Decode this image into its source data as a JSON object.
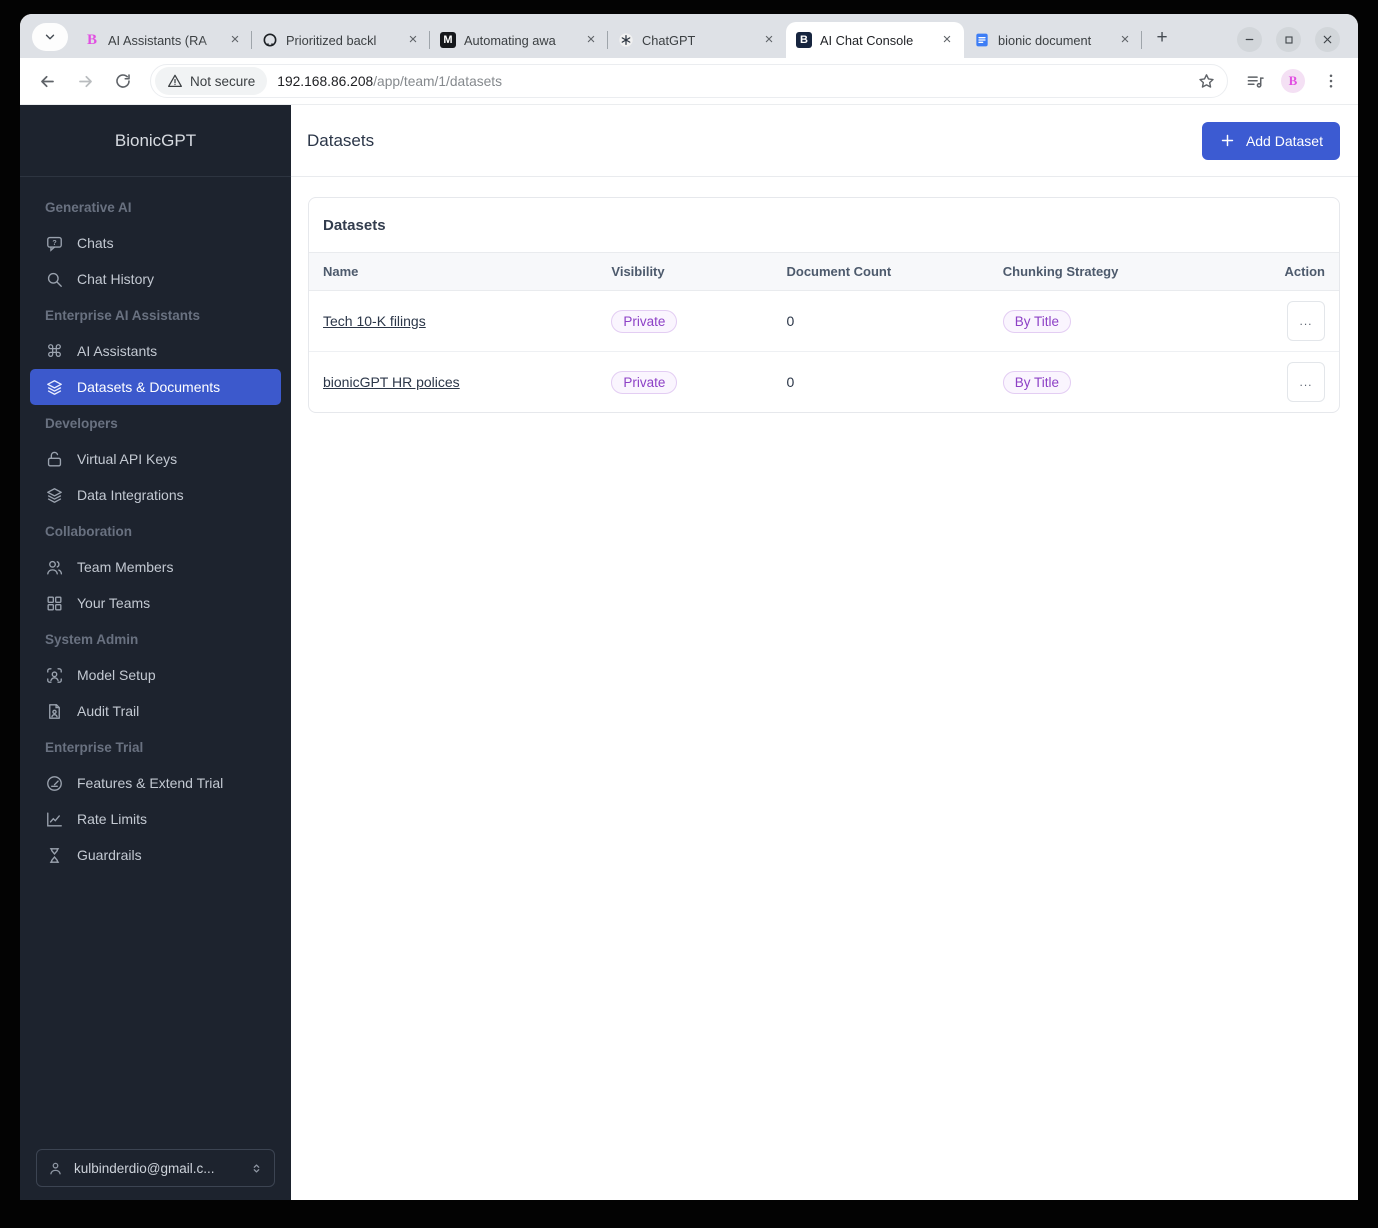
{
  "browser": {
    "tabs": [
      {
        "title": "AI Assistants (RA",
        "favicon": "bionic-pink",
        "active": false
      },
      {
        "title": "Prioritized backl",
        "favicon": "github",
        "active": false
      },
      {
        "title": "Automating awa",
        "favicon": "medium",
        "active": false
      },
      {
        "title": "ChatGPT",
        "favicon": "chatgpt",
        "active": false
      },
      {
        "title": "AI Chat Console",
        "favicon": "bionic-navy",
        "active": true
      },
      {
        "title": "bionic document",
        "favicon": "docs",
        "active": false
      }
    ],
    "security_label": "Not secure",
    "url_host": "192.168.86.208",
    "url_path": "/app/team/1/datasets"
  },
  "sidebar": {
    "brand": "BionicGPT",
    "sections": [
      {
        "label": "Generative AI",
        "items": [
          {
            "label": "Chats",
            "icon": "chat"
          },
          {
            "label": "Chat History",
            "icon": "search"
          }
        ]
      },
      {
        "label": "Enterprise AI Assistants",
        "items": [
          {
            "label": "AI Assistants",
            "icon": "command"
          },
          {
            "label": "Datasets & Documents",
            "icon": "stack",
            "active": true
          }
        ]
      },
      {
        "label": "Developers",
        "items": [
          {
            "label": "Virtual API Keys",
            "icon": "lock-open"
          },
          {
            "label": "Data Integrations",
            "icon": "stack"
          }
        ]
      },
      {
        "label": "Collaboration",
        "items": [
          {
            "label": "Team Members",
            "icon": "users"
          },
          {
            "label": "Your Teams",
            "icon": "grid"
          }
        ]
      },
      {
        "label": "System Admin",
        "items": [
          {
            "label": "Model Setup",
            "icon": "user-scan"
          },
          {
            "label": "Audit Trail",
            "icon": "file-user"
          }
        ]
      },
      {
        "label": "Enterprise Trial",
        "items": [
          {
            "label": "Features & Extend Trial",
            "icon": "gauge"
          },
          {
            "label": "Rate Limits",
            "icon": "chart"
          },
          {
            "label": "Guardrails",
            "icon": "hourglass"
          }
        ]
      }
    ],
    "user_email": "kulbinderdio@gmail.c..."
  },
  "main": {
    "page_title": "Datasets",
    "add_button_label": "Add Dataset",
    "card_title": "Datasets",
    "table": {
      "columns": [
        "Name",
        "Visibility",
        "Document Count",
        "Chunking Strategy",
        "Action"
      ],
      "rows": [
        {
          "name": "Tech 10-K filings",
          "visibility": "Private",
          "document_count": "0",
          "chunking_strategy": "By Title",
          "action": "..."
        },
        {
          "name": "bionicGPT HR polices",
          "visibility": "Private",
          "document_count": "0",
          "chunking_strategy": "By Title",
          "action": "..."
        }
      ]
    }
  },
  "colors": {
    "accent_blue": "#3c5bd2",
    "sidebar_bg": "#1d232e",
    "pill_bg": "#faf5fe",
    "pill_border": "#e3cdf3",
    "pill_text": "#8d41c6",
    "tabstrip_bg": "#dee1e6"
  }
}
